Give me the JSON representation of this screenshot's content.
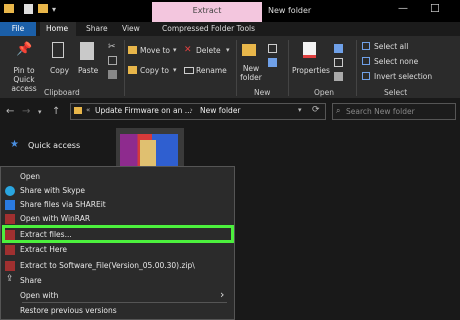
{
  "window": {
    "context_tab": "Extract",
    "title": "New folder",
    "minimize_glyph": "—",
    "maximize_glyph": "☐"
  },
  "ribbon_tabs": {
    "file": "File",
    "home": "Home",
    "share": "Share",
    "view": "View",
    "compressed_tools": "Compressed Folder Tools"
  },
  "ribbon": {
    "clipboard": {
      "pin_label": "Pin to Quick access",
      "copy_label": "Copy",
      "paste_label": "Paste",
      "group_label": "Clipboard"
    },
    "organize": {
      "move_to": "Move to",
      "copy_to": "Copy to",
      "delete": "Delete",
      "rename": "Rename"
    },
    "new": {
      "new_folder": "New folder",
      "group_label": "New"
    },
    "open": {
      "properties": "Properties",
      "group_label": "Open"
    },
    "select": {
      "select_all": "Select all",
      "select_none": "Select none",
      "invert": "Invert selection",
      "group_label": "Select"
    }
  },
  "address": {
    "crumb1": "Update Firmware on an ...",
    "crumb2": "New folder",
    "search_placeholder": "Search New folder"
  },
  "sidebar": {
    "quick_access": "Quick access"
  },
  "context_menu": {
    "items": [
      "Open",
      "Share with Skype",
      "Share files via SHAREit",
      "Open with WinRAR",
      "Extract files...",
      "Extract Here",
      "Extract to Software_File(Version_05.00.30).zip\\",
      "Share",
      "Open with",
      "Restore previous versions"
    ],
    "submenu_arrow": "›"
  },
  "colors": {
    "highlight": "#4cf03d",
    "accent": "#1b5fa8",
    "context_tab": "#f3c6de"
  }
}
